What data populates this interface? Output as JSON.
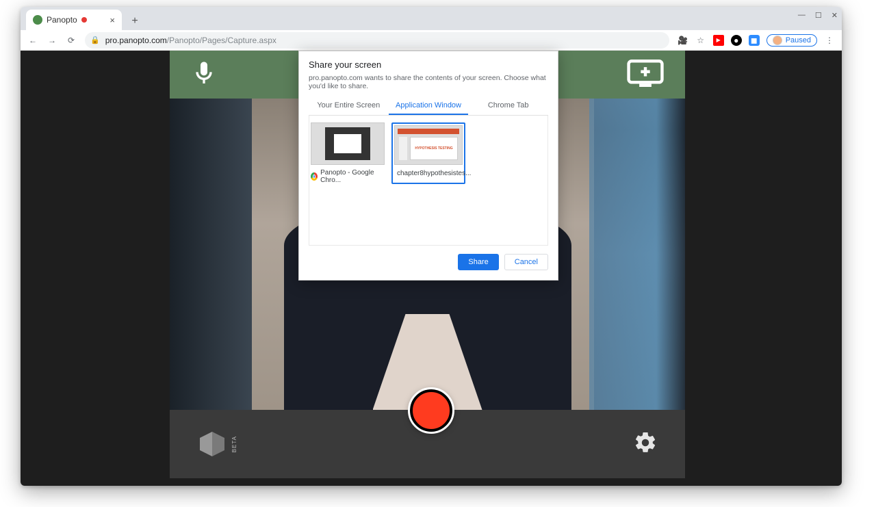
{
  "browser": {
    "tab_title": "Panopto",
    "url_host": "pro.panopto.com",
    "url_path": "/Panopto/Pages/Capture.aspx",
    "profile_status": "Paused"
  },
  "app": {
    "beta_label": "BETA"
  },
  "modal": {
    "title": "Share your screen",
    "subtitle": "pro.panopto.com wants to share the contents of your screen. Choose what you'd like to share.",
    "tabs": {
      "entire": "Your Entire Screen",
      "appwin": "Application Window",
      "chrometab": "Chrome Tab"
    },
    "thumbs": {
      "chrome": "Panopto - Google Chro...",
      "ppt": "chapter8hypothesistes..."
    },
    "buttons": {
      "share": "Share",
      "cancel": "Cancel"
    }
  }
}
